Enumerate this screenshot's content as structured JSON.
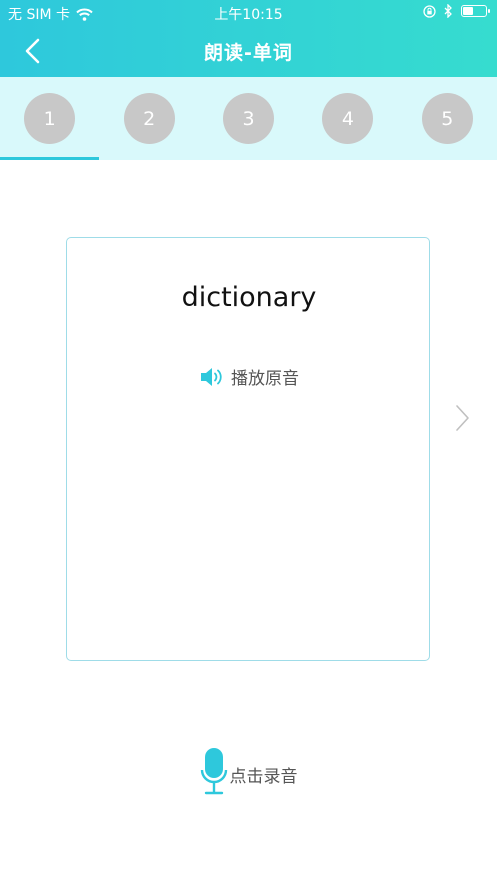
{
  "status_bar": {
    "carrier": "无 SIM 卡",
    "time": "上午10:15"
  },
  "nav": {
    "title": "朗读-单词"
  },
  "tabs": [
    {
      "label": "1",
      "active": true
    },
    {
      "label": "2",
      "active": false
    },
    {
      "label": "3",
      "active": false
    },
    {
      "label": "4",
      "active": false
    },
    {
      "label": "5",
      "active": false
    }
  ],
  "card": {
    "word": "dictionary",
    "play_label": "播放原音"
  },
  "record": {
    "label": "点击录音"
  },
  "colors": {
    "accent": "#2ec8dc",
    "tab_bg": "#d9f9fb",
    "circle_inactive": "#c8c8c8",
    "card_border": "#9fdce8"
  },
  "icons": {
    "back": "chevron-left-icon",
    "speaker": "speaker-icon",
    "next": "chevron-right-icon",
    "microphone": "microphone-icon"
  }
}
